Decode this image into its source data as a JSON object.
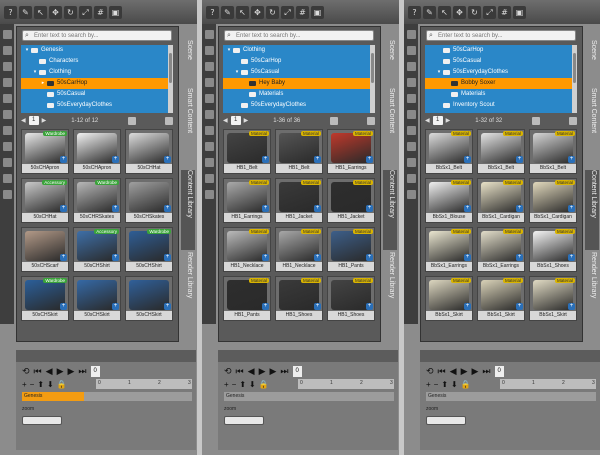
{
  "toolbar_icons": [
    "question-icon",
    "tool-icon",
    "cursor-icon",
    "move-icon",
    "rotate-icon",
    "scale-icon",
    "grid-icon",
    "camera-icon"
  ],
  "tabs": [
    "Scene",
    "Smart Content",
    "Content Library",
    "Render Library"
  ],
  "search_placeholder": "Enter text to search by...",
  "colors": {
    "tree_bg": "#2a87c8",
    "selected": "#ff9900",
    "badge_green": "#3aa33a",
    "badge_yellow": "#d9b400"
  },
  "windows": [
    {
      "tree": [
        {
          "label": "Genesis",
          "indent": 0,
          "twisty": "▾"
        },
        {
          "label": "Characters",
          "indent": 1,
          "twisty": ""
        },
        {
          "label": "Clothing",
          "indent": 1,
          "twisty": "▾"
        },
        {
          "label": "50sCarHop",
          "indent": 2,
          "twisty": "▸",
          "selected": true
        },
        {
          "label": "50sCasual",
          "indent": 2,
          "twisty": ""
        },
        {
          "label": "50sEverydayClothes",
          "indent": 2,
          "twisty": ""
        },
        {
          "label": "Inventory Scout",
          "indent": 2,
          "twisty": ""
        }
      ],
      "page": "1",
      "range": "1-12 of 12",
      "items": [
        {
          "caption": "50sCHApron",
          "badge": "Wardrobe",
          "badge_color": "green",
          "color": "#e8e8e8"
        },
        {
          "caption": "50sCHApron",
          "badge": "",
          "color": "#f2f2f2"
        },
        {
          "caption": "50sCHHat",
          "badge": "",
          "color": "#dddddd"
        },
        {
          "caption": "50sCHHat",
          "badge": "Accessory",
          "badge_color": "green",
          "color": "#c9c9c9"
        },
        {
          "caption": "50sCHRSkates",
          "badge": "Wardrobe",
          "badge_color": "green",
          "color": "#b8b8b8"
        },
        {
          "caption": "50sCHSkates",
          "badge": "",
          "color": "#a0a0a0"
        },
        {
          "caption": "50sCHScarf",
          "badge": "",
          "color": "#b39a88"
        },
        {
          "caption": "50sCHShirt",
          "badge": "Accessory",
          "badge_color": "green",
          "color": "#3e6fa8"
        },
        {
          "caption": "50sCHShirt",
          "badge": "Wardrobe",
          "badge_color": "green",
          "color": "#2f5e96"
        },
        {
          "caption": "50sCHSkirt",
          "badge": "Wardrobe",
          "badge_color": "green",
          "color": "#2b5f9a"
        },
        {
          "caption": "50sCHSkirt",
          "badge": "",
          "color": "#3569a6"
        },
        {
          "caption": "50sCHSkirt",
          "badge": "",
          "color": "#30609a"
        }
      ],
      "active_tab": "Content Library"
    },
    {
      "tree": [
        {
          "label": "Clothing",
          "indent": 0,
          "twisty": "▾"
        },
        {
          "label": "50sCarHop",
          "indent": 1,
          "twisty": ""
        },
        {
          "label": "50sCasual",
          "indent": 1,
          "twisty": "▾"
        },
        {
          "label": "Hey Baby",
          "indent": 2,
          "twisty": "",
          "selected": true
        },
        {
          "label": "Materials",
          "indent": 2,
          "twisty": ""
        },
        {
          "label": "50sEverydayClothes",
          "indent": 1,
          "twisty": ""
        }
      ],
      "page": "1",
      "range": "1-36 of 36",
      "items": [
        {
          "caption": "HB1_Belt",
          "badge": "Material",
          "badge_color": "yellow",
          "color": "#444444"
        },
        {
          "caption": "HB1_Belt",
          "badge": "Material",
          "badge_color": "yellow",
          "color": "#555555"
        },
        {
          "caption": "HB1_Earrings",
          "badge": "Material",
          "badge_color": "yellow",
          "color": "#c0392b"
        },
        {
          "caption": "HB1_Earrings",
          "badge": "Material",
          "badge_color": "yellow",
          "color": "#aaaaaa"
        },
        {
          "caption": "HB1_Jacket",
          "badge": "Material",
          "badge_color": "yellow",
          "color": "#3a3a3a"
        },
        {
          "caption": "HB1_Jacket",
          "badge": "Material",
          "badge_color": "yellow",
          "color": "#2e2e2e"
        },
        {
          "caption": "HB1_Necklace",
          "badge": "Material",
          "badge_color": "yellow",
          "color": "#bbbbbb"
        },
        {
          "caption": "HB1_Necklace",
          "badge": "Material",
          "badge_color": "yellow",
          "color": "#a8a8a8"
        },
        {
          "caption": "HB1_Pants",
          "badge": "Material",
          "badge_color": "yellow",
          "color": "#3d5f8a"
        },
        {
          "caption": "HB1_Pants",
          "badge": "Material",
          "badge_color": "yellow",
          "color": "#2e2e2e"
        },
        {
          "caption": "HB1_Shoes",
          "badge": "Material",
          "badge_color": "yellow",
          "color": "#3a3a3a"
        },
        {
          "caption": "HB1_Shoes",
          "badge": "Material",
          "badge_color": "yellow",
          "color": "#444444"
        }
      ],
      "active_tab": "Content Library"
    },
    {
      "tree": [
        {
          "label": "50sCarHop",
          "indent": 1,
          "twisty": ""
        },
        {
          "label": "50sCasual",
          "indent": 1,
          "twisty": ""
        },
        {
          "label": "50sEverydayClothes",
          "indent": 1,
          "twisty": "▾"
        },
        {
          "label": "Bobby Soxer",
          "indent": 2,
          "twisty": "",
          "selected": true
        },
        {
          "label": "Materials",
          "indent": 2,
          "twisty": ""
        },
        {
          "label": "Inventory Scout",
          "indent": 1,
          "twisty": ""
        }
      ],
      "page": "1",
      "range": "1-32 of 32",
      "items": [
        {
          "caption": "BbSx1_Belt",
          "badge": "Material",
          "badge_color": "yellow",
          "color": "#dcdcdc"
        },
        {
          "caption": "BbSx1_Belt",
          "badge": "Material",
          "badge_color": "yellow",
          "color": "#e4e4e4"
        },
        {
          "caption": "BbSx1_Belt",
          "badge": "Material",
          "badge_color": "yellow",
          "color": "#d6d6d6"
        },
        {
          "caption": "BbSx1_Blouse",
          "badge": "Material",
          "badge_color": "yellow",
          "color": "#f0f0f0"
        },
        {
          "caption": "BbSx1_Cardigan",
          "badge": "Material",
          "badge_color": "yellow",
          "color": "#e9e2c8"
        },
        {
          "caption": "BbSx1_Cardigan",
          "badge": "Material",
          "badge_color": "yellow",
          "color": "#e2d9bd"
        },
        {
          "caption": "BbSx1_Earrings",
          "badge": "Material",
          "badge_color": "yellow",
          "color": "#eae6d0"
        },
        {
          "caption": "BbSx1_Earrings",
          "badge": "Material",
          "badge_color": "yellow",
          "color": "#e3deca"
        },
        {
          "caption": "BbSx1_Shoes",
          "badge": "Material",
          "badge_color": "yellow",
          "color": "#f4f4f4"
        },
        {
          "caption": "BbSx1_Skirt",
          "badge": "Material",
          "badge_color": "yellow",
          "color": "#ddd7c0"
        },
        {
          "caption": "BbSx1_Skirt",
          "badge": "Material",
          "badge_color": "yellow",
          "color": "#d9d2b8"
        },
        {
          "caption": "BbSx1_Skirt",
          "badge": "Material",
          "badge_color": "yellow",
          "color": "#e1dbc4"
        }
      ],
      "active_tab": "Content Library"
    }
  ],
  "timeline": {
    "track": "Genesis",
    "ruler_ticks": [
      "0",
      "1",
      "2",
      "3"
    ],
    "zoom_label": "zoom",
    "frame": "0"
  }
}
